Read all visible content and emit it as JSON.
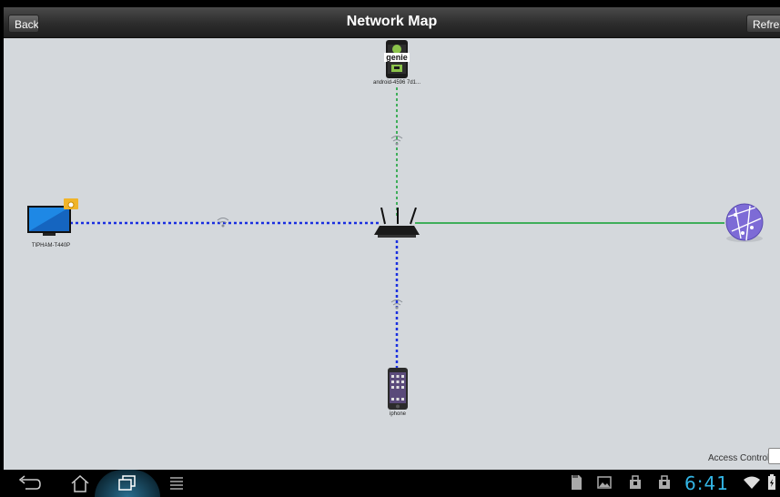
{
  "titlebar": {
    "title": "Network Map",
    "back_label": "Back",
    "refresh_label": "Refresh"
  },
  "map": {
    "nodes": {
      "phone_top": {
        "label": "android-4596 7d1...",
        "app_name": "genie",
        "icon": "netgear-genie-android-icon"
      },
      "computer": {
        "label": "TIPHAM-T440P",
        "icon": "monitor-icon"
      },
      "router": {
        "icon": "router-icon"
      },
      "internet": {
        "icon": "globe-internet-icon"
      },
      "iphone": {
        "label": "iphone",
        "icon": "iphone-icon"
      }
    },
    "links": [
      {
        "from": "router",
        "to": "phone_top",
        "type": "wireless"
      },
      {
        "from": "router",
        "to": "computer",
        "type": "wireless"
      },
      {
        "from": "router",
        "to": "iphone",
        "type": "wireless"
      },
      {
        "from": "router",
        "to": "internet",
        "type": "wired"
      }
    ],
    "colors": {
      "wired": "#3fae5a",
      "wireless_blue": "#1a2fe0",
      "wireless_green": "#3fae5a",
      "background": "#d4d8dc"
    }
  },
  "access_control": {
    "label": "Access Control"
  },
  "navbar": {
    "clock": "6:41",
    "icons": [
      "back-icon",
      "home-icon",
      "recent-apps-icon",
      "menu-icon",
      "sd-card-icon",
      "gallery-icon",
      "notification-icon",
      "notification-icon",
      "wifi-icon",
      "battery-icon"
    ]
  }
}
